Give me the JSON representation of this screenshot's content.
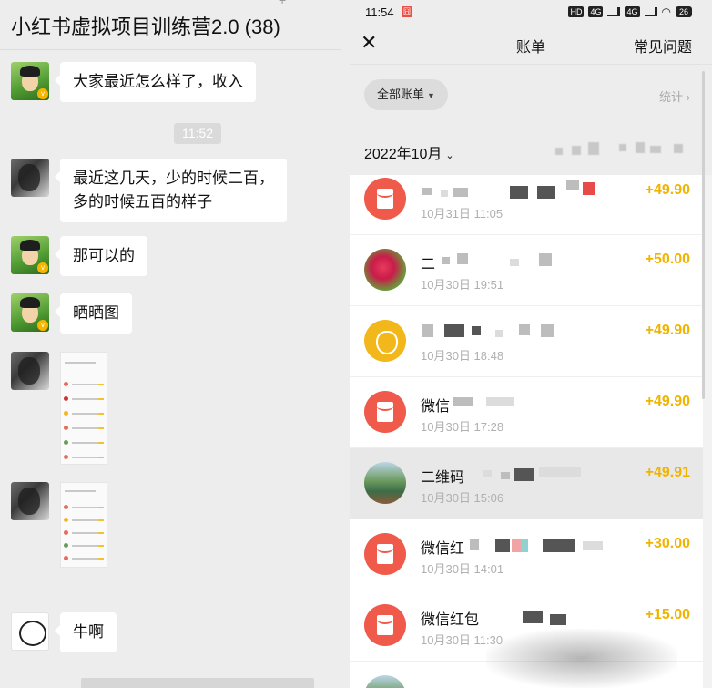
{
  "chat": {
    "title": "小红书虚拟项目训练营2.0 (38)",
    "time_separator": "11:52",
    "messages": [
      {
        "text": "大家最近怎么样了，收入"
      },
      {
        "text_line1": "最近这几天，少的时候二百，",
        "text_line2": "多的时候五百的样子"
      },
      {
        "text": "那可以的"
      },
      {
        "text": "晒晒图"
      },
      {
        "text": "牛啊"
      }
    ],
    "badge_letter": "v"
  },
  "bill": {
    "statusbar": {
      "time": "11:54",
      "hd": "HD",
      "sig1": "4G",
      "sig2": "4G",
      "battery": "26"
    },
    "nav": {
      "title": "账单",
      "help": "常见问题",
      "close_symbol": "✕"
    },
    "filter": {
      "pill_label": "全部账单",
      "stats_label": "统计"
    },
    "month": {
      "label": "2022年10月"
    },
    "transactions": [
      {
        "title": "",
        "date": "10月31日 11:05",
        "amount": "+49.90",
        "icon": "redpacket-icon"
      },
      {
        "title": "二",
        "date": "10月30日 19:51",
        "amount": "+50.00",
        "icon": "flower-avatar-icon"
      },
      {
        "title": "",
        "date": "10月30日 18:48",
        "amount": "+49.90",
        "icon": "moneybag-icon"
      },
      {
        "title": "微信",
        "date": "10月30日 17:28",
        "amount": "+49.90",
        "icon": "redpacket-icon"
      },
      {
        "title": "二维码",
        "date": "10月30日 15:06",
        "amount": "+49.91",
        "icon": "landscape-avatar-icon"
      },
      {
        "title": "微信红",
        "date": "10月30日 14:01",
        "amount": "+30.00",
        "icon": "redpacket-icon"
      },
      {
        "title": "微信红包",
        "date": "10月30日 11:30",
        "amount": "+15.00",
        "icon": "redpacket-icon"
      }
    ],
    "accent_color": "#f0b400",
    "redpacket_color": "#ef5a4b"
  }
}
